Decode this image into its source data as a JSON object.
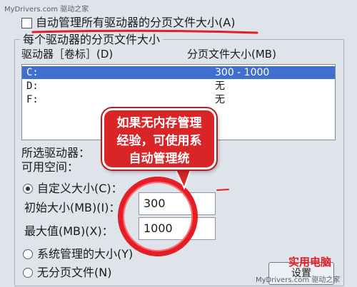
{
  "watermark_top": "MyDrivers.com 驱动之家",
  "auto_manage": {
    "label": "自动管理所有驱动器的分页文件大小",
    "accel": "(A)",
    "checked": false
  },
  "group": {
    "title": "每个驱动器的分页文件大小",
    "col_drive": "驱动器［卷标］(D)",
    "col_size": "分页文件大小(MB)"
  },
  "drives": [
    {
      "drive": "C:",
      "size": "300 - 1000",
      "selected": true
    },
    {
      "drive": "D:",
      "size": "无",
      "selected": false
    },
    {
      "drive": "F:",
      "size": "无",
      "selected": false
    }
  ],
  "selected_drive_label": "所选驱动器：",
  "available_space_label": "可用空间：",
  "custom_size": {
    "label": "自定义大小(C)：",
    "selected": true
  },
  "initial_size": {
    "label": "初始大小(MB)(I)：",
    "value": "300"
  },
  "max_size": {
    "label": "最大值(MB)(X)：",
    "value": "1000"
  },
  "system_managed": {
    "label": "系统管理的大小(Y)",
    "selected": false
  },
  "no_paging": {
    "label": "无分页文件(N)",
    "selected": false
  },
  "set_button": {
    "label": "设置"
  },
  "callout": {
    "lines": [
      "如果无内存管理",
      "经验，可使用系",
      "自动管理统"
    ]
  },
  "logo_text": "实用电脑",
  "watermark_bottom": "MyDrivers.com 驱动之家",
  "colors": {
    "accent": "#e41e26",
    "selection": "#3f6fcf"
  }
}
